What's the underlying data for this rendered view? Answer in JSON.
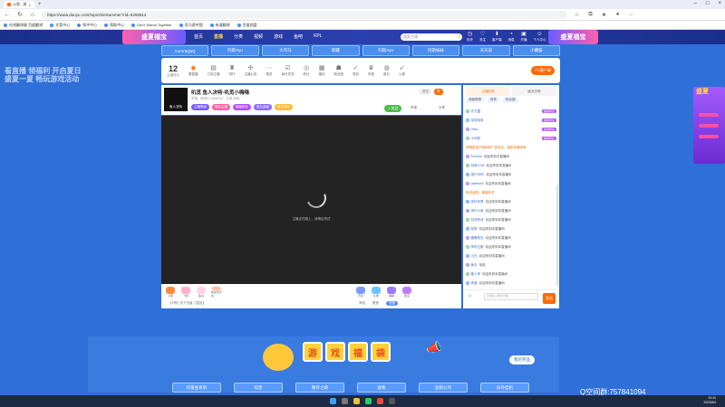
{
  "browser": {
    "tab_title": "斗鱼 - 斑",
    "address": "https://www.douyu.com/topic/XieSummer?rid=5266914",
    "bookmarks": [
      "在线翻译器 百度翻译",
      "文案中心",
      "知乎中心",
      "帮助中心",
      "Don't Starve Together",
      "亚马逊中国",
      "有道翻译",
      "百度网盘"
    ]
  },
  "header": {
    "logo_text": "盛夏福宝",
    "nav": [
      "首页",
      "直播",
      "分类",
      "视频",
      "游戏",
      "鱼吧",
      "KPL"
    ],
    "active_nav": "直播",
    "search_placeholder": "搜索主播",
    "user_icons": [
      "历史",
      "关注",
      "客户端",
      "消息",
      "开播",
      "个人中心"
    ],
    "right_logo_text": "盛夏福宝"
  },
  "bg_text": [
    "看直播 领福利 开启夏日",
    "盛夏一夏 畅玩游戏活动"
  ],
  "categories": [
    "AuroraQaQ",
    "阿斯Ayu",
    "大司马",
    "新疆",
    "阿斯Ayu",
    "阿斯妹妹",
    "天天说",
    "小槽猫"
  ],
  "quick_bar": {
    "count": "12",
    "count_label": "主播成长",
    "items": [
      "看直播",
      "订阅主播",
      "排行",
      "主播公告",
      "更多",
      "每日任务",
      "积分",
      "福利",
      "粉丝团",
      "签到",
      "贵族",
      "鱼丸",
      "火箭"
    ],
    "pc_button": "PC客户端"
  },
  "room": {
    "title": "叽觅 鱼人决特·叽觅小嗨嗨",
    "meta": "举报 · 房间ID 5266914 · 分类 游戏",
    "tags": [
      "主播等级",
      "最佳主播",
      "超级粉丝",
      "鱼丸贡献",
      "夏日活动"
    ],
    "follow": "+ 关注",
    "report": "举报",
    "share": "分享",
    "top_mini": [
      "关注",
      "赞"
    ],
    "avatar_label": "鱼人决特",
    "video_status": "主播正在路上，请稍后再试"
  },
  "gifts": {
    "left": [
      "火箭",
      "飞机",
      "鱼丸",
      "粉丝荧光棒"
    ],
    "right": [
      "背包",
      "礼物",
      "福袋",
      "更多"
    ],
    "gift_line": "【1号】天下无敌 【送礼】",
    "actions": [
      "背包",
      "更多",
      "充值"
    ]
  },
  "side": {
    "tabs": [
      "主播任务",
      "欧派日榜"
    ],
    "sub_tabs": [
      "贡献周榜",
      "贵宾",
      "粉丝团"
    ],
    "messages": [
      {
        "lv": "7",
        "nick": "东方翼",
        "text": "",
        "badge": "超级粉丝"
      },
      {
        "lv": "8",
        "nick": "哈哈哈哈",
        "text": "",
        "badge": "超级粉丝"
      },
      {
        "lv": "9",
        "nick": "Ultra",
        "text": "",
        "badge": "超级粉丝"
      },
      {
        "lv": "3",
        "nick": "小司机",
        "text": "",
        "badge": "超级粉丝"
      },
      {
        "lv": "",
        "nick": "",
        "text": "请尊重用户隐私和广告安全，谨防诈骗消息",
        "sys": true
      },
      {
        "lv": "5",
        "nick": "Tortoise",
        "text": "欢迎来到本直播间",
        "badge": ""
      },
      {
        "lv": "3",
        "nick": "玩家1234",
        "text": "欢迎来到本直播间",
        "badge": ""
      },
      {
        "lv": "4",
        "nick": "用户9887",
        "text": "欢迎来到本直播间",
        "badge": ""
      },
      {
        "lv": "6",
        "nick": "palewind",
        "text": "欢迎来到本直播间",
        "badge": ""
      },
      {
        "lv": "",
        "nick": "",
        "text": "系统消息，弹幕开关",
        "sys": true
      },
      {
        "lv": "2",
        "nick": "你好世界",
        "text": "欢迎来到本直播间",
        "badge": ""
      },
      {
        "lv": "7",
        "nick": "快乐小鱼",
        "text": "欢迎来到本直播间",
        "badge": ""
      },
      {
        "lv": "8",
        "nick": "叽觅粉丝",
        "text": "欢迎来到本直播间",
        "badge": ""
      },
      {
        "lv": "3",
        "nick": "回家",
        "text": "欢迎来到本直播间",
        "badge": ""
      },
      {
        "lv": "5",
        "nick": "晨曦阳光",
        "text": "欢迎来到本直播间",
        "badge": ""
      },
      {
        "lv": "4",
        "nick": "风吹云散",
        "text": "欢迎来到本直播间",
        "badge": ""
      },
      {
        "lv": "6",
        "nick": "小白",
        "text": "欢迎来到本直播间",
        "badge": ""
      },
      {
        "lv": "2",
        "nick": "鱼丸",
        "text": "哈哈",
        "badge": ""
      },
      {
        "lv": "9",
        "nick": "路人甲",
        "text": "欢迎来到本直播间",
        "badge": ""
      },
      {
        "lv": "3",
        "nick": "夜猫",
        "text": "欢迎来到本直播间",
        "badge": ""
      }
    ],
    "input_placeholder": "这里输入聊天内容",
    "send": "发送"
  },
  "right_banner_text": "盛夏",
  "promo": {
    "title": [
      "游",
      "戏",
      "福",
      "袋"
    ],
    "my_prize": "我的奖品",
    "tabs": [
      "科雷金系列",
      "叽觅",
      "数许之路",
      "就看",
      "鱼粉公司",
      "旧外挂机"
    ]
  },
  "watermark": "Q空间群:757841094",
  "taskbar": {
    "time": "20:11",
    "date": "2023/8/4"
  }
}
